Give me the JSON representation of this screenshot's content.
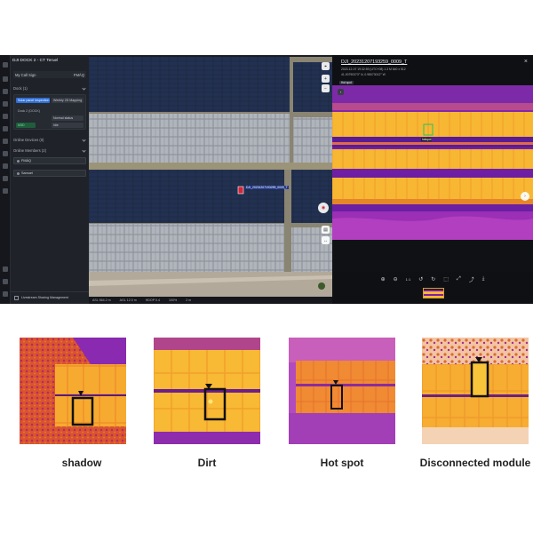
{
  "app": {
    "window_title": "DJI DOCK 2 - CT Teruel",
    "sidebar": {
      "call_sign_label": "My Call Sign",
      "call_sign_value": "FMÁQ",
      "dock_section": "Dock (1)",
      "dock_task_1": "Solar panel inspection - Dirt / shadow",
      "dock_task_2": "Weekly 2D Mapping",
      "dock_name": "Dock 2 (DOCK)",
      "dock_status": "Normal status",
      "dock_drone": "M3D",
      "dock_state": "Idle",
      "online_devices": "Online Devices (0)",
      "online_members": "Online Members (2)",
      "members": [
        "FMÁQ",
        "Samuel"
      ],
      "footer": "Livestream Sharing Management"
    },
    "map": {
      "target_label": "DJI_20231207193259_0009_T",
      "status_items": [
        "ASL 564.2 m",
        "AGL 12.0 m",
        "HDOP 0.4",
        "100%",
        "2 m"
      ]
    },
    "thermal_viewer": {
      "title": "DJI_20231207193259_0009_T",
      "meta_line_1": "2023-12-07 19:32:59 (UTC+08)  1.3 M  640 x 512",
      "meta_line_2": "41.00790373° N, 0.98073012° W",
      "chip": "Hot spot",
      "hotspot_label": "hotspot",
      "tools": [
        "zoom-in",
        "zoom-out",
        "1:1",
        "rotate-left",
        "rotate-right",
        "crop",
        "fullscreen",
        "share",
        "download"
      ],
      "tool_glyphs": [
        "⊕",
        "⊖",
        "1:1",
        "↺",
        "↻",
        "⬚",
        "⤢",
        "⤴",
        "⤓"
      ]
    }
  },
  "examples": [
    {
      "label": "shadow",
      "kind": "shadow"
    },
    {
      "label": "Dirt",
      "kind": "dirt"
    },
    {
      "label": "Hot spot",
      "kind": "hotspot"
    },
    {
      "label": "Disconnected module",
      "kind": "disconnected"
    }
  ],
  "colors": {
    "ironbow_hot": "#ffd23d",
    "ironbow_warm": "#f0902a",
    "ironbow_mid": "#c23d6e",
    "ironbow_cool": "#7a1fa8",
    "ironbow_cold": "#3b0b74",
    "accent": "#2f6fd6"
  }
}
